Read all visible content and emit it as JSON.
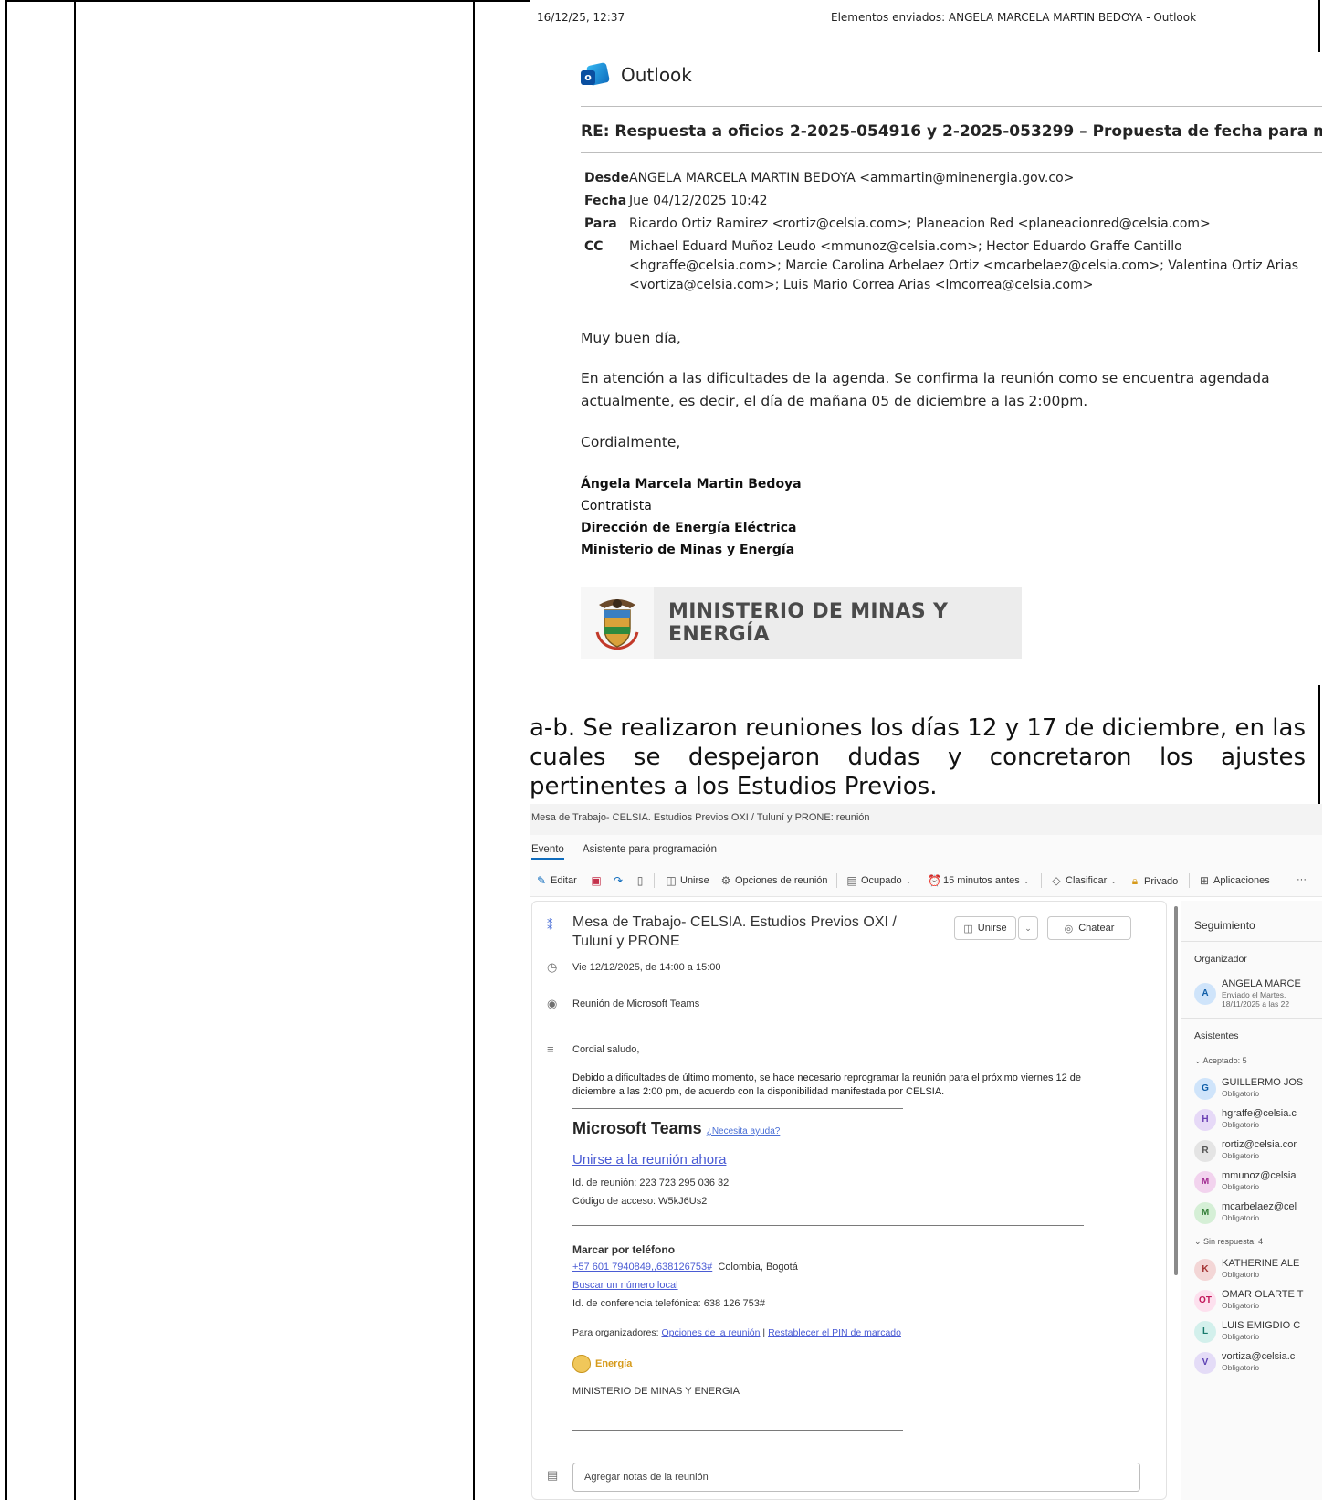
{
  "email": {
    "print_date": "16/12/25, 12:37",
    "print_title": "Elementos enviados: ANGELA MARCELA MARTIN BEDOYA - Outlook",
    "app_name": "Outlook",
    "subject": "RE: Respuesta a oficios 2-2025-054916 y 2-2025-053299 – Propuesta de fecha para mesa de trabajo",
    "from_label": "Desde",
    "from_value": "ANGELA MARCELA MARTIN BEDOYA <ammartin@minenergia.gov.co>",
    "date_label": "Fecha",
    "date_value": "Jue 04/12/2025 10:42",
    "to_label": "Para",
    "to_value": "Ricardo Ortiz Ramirez <rortiz@celsia.com>; Planeacion Red <planeacionred@celsia.com>",
    "cc_label": "CC",
    "cc_line1": "Michael Eduard Muñoz Leudo <mmunoz@celsia.com>; Hector Eduardo Graffe Cantillo",
    "cc_line2": "<hgraffe@celsia.com>; Marcie Carolina Arbelaez Ortiz <mcarbelaez@celsia.com>; Valentina Ortiz Arias",
    "cc_line3": "<vortiza@celsia.com>; Luis Mario Correa Arias <lmcorrea@celsia.com>",
    "greeting": "Muy buen día,",
    "body_line1": "En atención a las dificultades de la agenda. Se confirma la reunión como se encuentra agendada",
    "body_line2": "actualmente, es decir, el día de mañana 05 de diciembre a las 2:00pm.",
    "closing": "Cordialmente,",
    "sig_name": "Ángela Marcela Martin Bedoya",
    "sig_role": "Contratista",
    "sig_dept": "Dirección de Energía Eléctrica",
    "sig_org": "Ministerio de Minas y Energía",
    "banner_line1": "MINISTERIO DE MINAS Y",
    "banner_line2": "ENERGÍA"
  },
  "narrative": "a-b. Se realizaron reuniones los días 12 y 17 de diciembre, en las cuales se despejaron dudas y concretaron los ajustes pertinentes a los Estudios Previos.",
  "event": {
    "window_title": "Mesa de Trabajo- CELSIA. Estudios Previos OXI / Tuluní y PRONE: reunión",
    "tabs": [
      "Evento",
      "Asistente para programación"
    ],
    "toolbar": {
      "edit": "Editar",
      "join": "Unirse",
      "meeting_options": "Opciones de reunión",
      "busy": "Ocupado",
      "reminder": "15 minutos antes",
      "classify": "Clasificar",
      "private": "Privado",
      "apps": "Aplicaciones",
      "more": "···"
    },
    "title": "Mesa de Trabajo- CELSIA. Estudios Previos OXI / Tuluní y PRONE",
    "join_button": "Unirse",
    "chat_button": "Chatear",
    "datetime": "Vie 12/12/2025, de 14:00 a 15:00",
    "location": "Reunión de Microsoft Teams",
    "salutation": "Cordial saludo,",
    "body_line1": "Debido a dificultades de último momento, se hace necesario reprogramar la reunión para el próximo viernes 12 de",
    "body_line2": "diciembre a las 2:00 pm, de acuerdo con la disponibilidad manifestada por CELSIA.",
    "teams_heading": "Microsoft Teams",
    "teams_help": "¿Necesita ayuda?",
    "join_link": "Unirse a la reunión ahora",
    "meeting_id": "Id. de reunión: 223 723 295 036 32",
    "access_code": "Código de acceso: W5kJ6Us2",
    "dial_heading": "Marcar por teléfono",
    "dial_number": "+57 601 7940849,,638126753#",
    "dial_city": "Colombia, Bogotá",
    "find_local": "Buscar un número local",
    "conference_id": "Id. de conferencia telefónica: 638 126 753#",
    "organizers_label": "Para organizadores:",
    "organizers_opt1": "Opciones de la reunión",
    "organizers_sep": "|",
    "organizers_opt2": "Restablecer el PIN de marcado",
    "energia_logo": "Energía",
    "ministry_footer": "MINISTERIO DE MINAS Y ENERGIA",
    "notes_placeholder": "Agregar notas de la reunión",
    "side": {
      "tracking": "Seguimiento",
      "organizer_label": "Organizador",
      "organizer_name": "ANGELA MARCE",
      "organizer_sent1": "Enviado el Martes,",
      "organizer_sent2": "18/11/2025 a las 22",
      "attendees_label": "Asistentes",
      "accepted_label": "Aceptado: 5",
      "noresponse_label": "Sin respuesta: 4",
      "accepted": [
        {
          "initials": "G",
          "name": "GUILLERMO JOS",
          "role": "Obligatorio",
          "bg": "#cfe4fa",
          "fg": "#0f5ea8"
        },
        {
          "initials": "H",
          "name": "hgraffe@celsia.c",
          "role": "Obligatorio",
          "bg": "#e6d9f7",
          "fg": "#6b3fb3"
        },
        {
          "initials": "R",
          "name": "rortiz@celsia.cor",
          "role": "Obligatorio",
          "bg": "#e4e4e4",
          "fg": "#555555"
        },
        {
          "initials": "M",
          "name": "mmunoz@celsia",
          "role": "Obligatorio",
          "bg": "#f2d3ee",
          "fg": "#a0288f"
        },
        {
          "initials": "M",
          "name": "mcarbelaez@cel",
          "role": "Obligatorio",
          "bg": "#d5efd6",
          "fg": "#2c7a31"
        }
      ],
      "no_response": [
        {
          "initials": "K",
          "name": "KATHERINE ALE",
          "role": "Obligatorio",
          "bg": "#f3d6d6",
          "fg": "#a33232"
        },
        {
          "initials": "OT",
          "name": "OMAR OLARTE T",
          "role": "Obligatorio",
          "bg": "#fde0ee",
          "fg": "#c2185b"
        },
        {
          "initials": "L",
          "name": "LUIS EMIGDIO C",
          "role": "Obligatorio",
          "bg": "#d3f0ec",
          "fg": "#177a6c"
        },
        {
          "initials": "V",
          "name": "vortiza@celsia.c",
          "role": "Obligatorio",
          "bg": "#e4dcf7",
          "fg": "#5b3fb3"
        }
      ]
    }
  }
}
